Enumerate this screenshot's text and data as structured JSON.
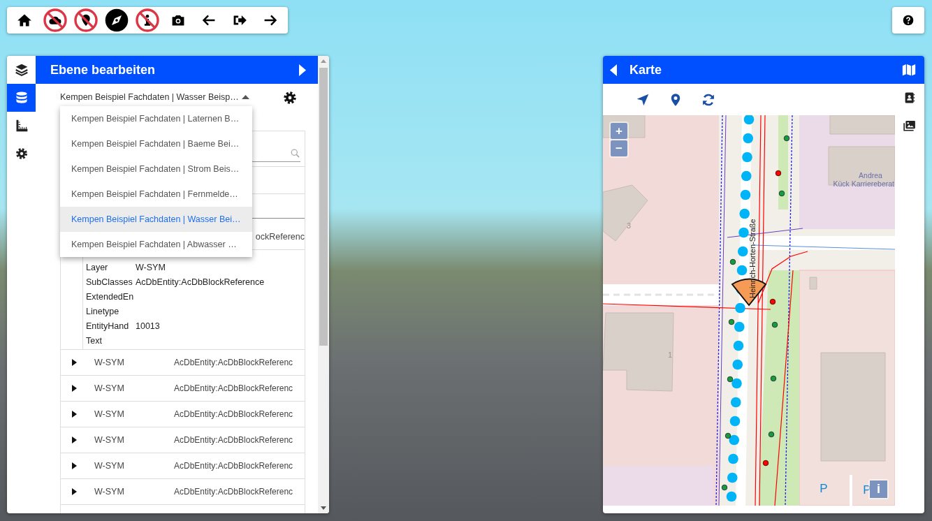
{
  "toolbar": {
    "buttons": [
      {
        "kind": "home",
        "off": false
      },
      {
        "kind": "cloud",
        "off": true
      },
      {
        "kind": "pin",
        "off": true
      },
      {
        "kind": "compass",
        "off": false
      },
      {
        "kind": "person",
        "off": true
      },
      {
        "kind": "camera",
        "off": false
      },
      {
        "kind": "back",
        "off": false
      },
      {
        "kind": "exit",
        "off": false
      },
      {
        "kind": "forward",
        "off": false
      }
    ]
  },
  "help_button": {
    "kind": "help"
  },
  "side_rail": [
    {
      "kind": "layers",
      "selected": false
    },
    {
      "kind": "database",
      "selected": true
    },
    {
      "kind": "ruler",
      "selected": false
    },
    {
      "kind": "settings",
      "selected": false
    }
  ],
  "edit_panel": {
    "title": "Ebene bearbeiten",
    "layer_select": {
      "value": "Kempen Beispiel Fachdaten | Wasser Beisp…",
      "expanded": true,
      "options": [
        {
          "label": "Kempen Beispiel Fachdaten | Laternen B…",
          "selected": false
        },
        {
          "label": "Kempen Beispiel Fachdaten | Baeme Bei…",
          "selected": false
        },
        {
          "label": "Kempen Beispiel Fachdaten | Strom Beis…",
          "selected": false
        },
        {
          "label": "Kempen Beispiel Fachdaten | Fernmelde…",
          "selected": false
        },
        {
          "label": "Kempen Beispiel Fachdaten | Wasser Bei…",
          "selected": true
        },
        {
          "label": "Kempen Beispiel Fachdaten | Abwasser …",
          "selected": false
        }
      ]
    },
    "table": {
      "covered_row_text": "ockReferenc",
      "detail": [
        {
          "key": "Layer",
          "value": "W-SYM"
        },
        {
          "key": "SubClasses",
          "value": "AcDbEntity:AcDbBlockReference"
        },
        {
          "key": "ExtendedEn"
        },
        {
          "key": "Linetype"
        },
        {
          "key": "EntityHand",
          "value": "10013"
        },
        {
          "key": "Text"
        }
      ],
      "rows": [
        {
          "layer": "W-SYM",
          "subclasses": "AcDbEntity:AcDbBlockReferenc",
          "expanded": false
        },
        {
          "layer": "W-SYM",
          "subclasses": "AcDbEntity:AcDbBlockReferenc",
          "expanded": false
        },
        {
          "layer": "W-SYM",
          "subclasses": "AcDbEntity:AcDbBlockReferenc",
          "expanded": false
        },
        {
          "layer": "W-SYM",
          "subclasses": "AcDbEntity:AcDbBlockReferenc",
          "expanded": false
        },
        {
          "layer": "W-SYM",
          "subclasses": "AcDbEntity:AcDbBlockReferenc",
          "expanded": false
        },
        {
          "layer": "W-SYM",
          "subclasses": "AcDbEntity:AcDbBlockReferenc",
          "expanded": false
        }
      ]
    }
  },
  "map_panel": {
    "title": "Karte",
    "tools": [
      {
        "kind": "navigate"
      },
      {
        "kind": "marker"
      },
      {
        "kind": "refresh"
      }
    ],
    "side_tools": [
      {
        "kind": "contacts"
      },
      {
        "kind": "images"
      }
    ],
    "map": {
      "zoom_in": "+",
      "zoom_out": "−",
      "info_button": "i",
      "labels": [
        {
          "kind": "house_number",
          "text": "3"
        },
        {
          "kind": "house_number",
          "text": "1"
        },
        {
          "kind": "poi",
          "text": "Andrea"
        },
        {
          "kind": "poi",
          "text": "Kück Karriereberat"
        },
        {
          "kind": "street",
          "text": "Heinrich-Horten-Straße"
        },
        {
          "kind": "parking",
          "text": "P"
        },
        {
          "kind": "parking",
          "text": "P"
        }
      ]
    }
  }
}
